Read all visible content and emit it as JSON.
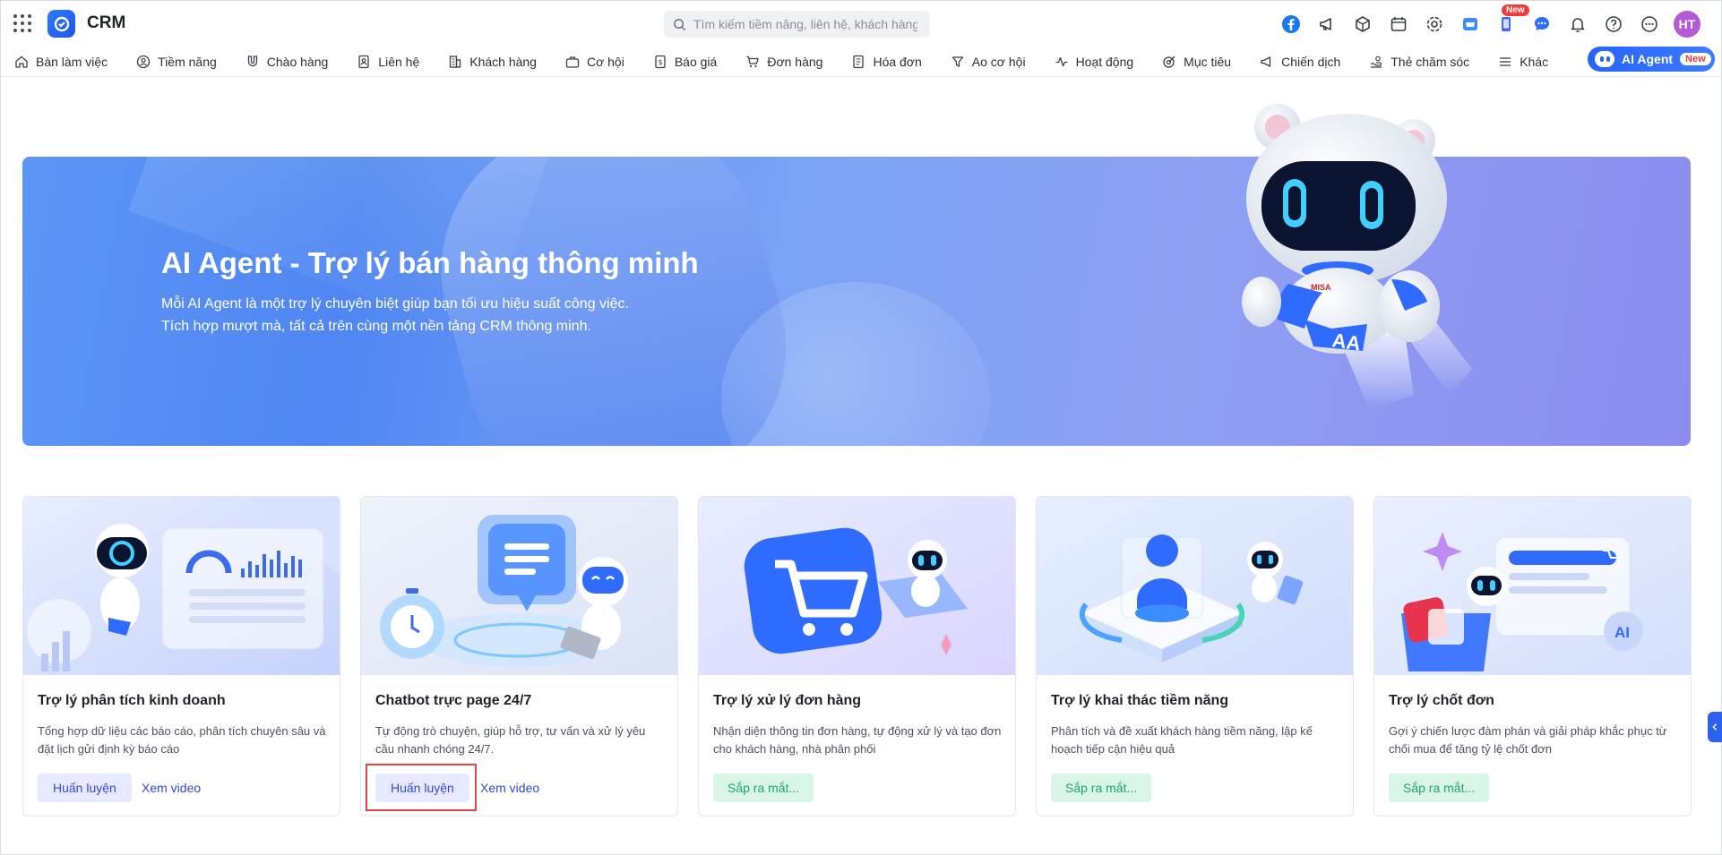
{
  "header": {
    "app_name": "CRM",
    "search_placeholder": "Tìm kiếm tiềm năng, liên hệ, khách hàng",
    "new_badge": "New",
    "avatar_initials": "HT"
  },
  "nav": {
    "items": [
      {
        "label": "Bàn làm việc",
        "icon": "home-icon"
      },
      {
        "label": "Tiềm năng",
        "icon": "prospect-icon"
      },
      {
        "label": "Chào hàng",
        "icon": "magnet-icon"
      },
      {
        "label": "Liên hệ",
        "icon": "contact-icon"
      },
      {
        "label": "Khách hàng",
        "icon": "building-icon"
      },
      {
        "label": "Cơ hội",
        "icon": "briefcase-icon"
      },
      {
        "label": "Báo giá",
        "icon": "quote-icon"
      },
      {
        "label": "Đơn hàng",
        "icon": "cart-icon"
      },
      {
        "label": "Hóa đơn",
        "icon": "invoice-icon"
      },
      {
        "label": "Ao cơ hội",
        "icon": "funnel-icon"
      },
      {
        "label": "Hoạt động",
        "icon": "activity-icon"
      },
      {
        "label": "Mục tiêu",
        "icon": "target-icon"
      },
      {
        "label": "Chiến dịch",
        "icon": "megaphone-icon"
      },
      {
        "label": "Thẻ chăm sóc",
        "icon": "care-card-icon"
      },
      {
        "label": "Khác",
        "icon": "menu-icon"
      }
    ],
    "ai_agent_label": "AI Agent",
    "ai_agent_badge": "New"
  },
  "banner": {
    "title": "AI Agent - Trợ lý bán hàng thông minh",
    "subtitle_line1": "Mỗi AI Agent là một trợ lý chuyên biệt giúp bạn tối ưu hiệu suất công việc.",
    "subtitle_line2": "Tích hợp mượt mà, tất cả trên cùng một nền tảng CRM thông minh.",
    "robot_badge": "MISA"
  },
  "cards": [
    {
      "title": "Trợ lý phân tích kinh doanh",
      "desc": "Tổng hợp dữ liệu các báo cáo, phân tích chuyên sâu và đặt lịch gửi định kỳ báo cáo",
      "train_label": "Huấn luyện",
      "video_label": "Xem video"
    },
    {
      "title": "Chatbot trực page 24/7",
      "desc": "Tự động trò chuyện, giúp hỗ trợ, tư vấn và xử lý yêu cầu nhanh chóng 24/7.",
      "train_label": "Huấn luyện",
      "video_label": "Xem video"
    },
    {
      "title": "Trợ lý xử lý đơn hàng",
      "desc": "Nhận diện thông tin đơn hàng, tự động xử lý và tạo đơn cho khách hàng, nhà phân phối",
      "soon_label": "Sắp ra mắt..."
    },
    {
      "title": "Trợ lý khai thác tiềm năng",
      "desc": "Phân tích và đề xuất khách hàng tiềm năng, lập kế hoạch tiếp cận hiệu quả",
      "soon_label": "Sắp ra mắt..."
    },
    {
      "title": "Trợ lý chốt đơn",
      "desc": "Gợi ý chiến lược đàm phán và giải pháp khắc phục từ chối mua để tăng tỷ lệ chốt đơn",
      "soon_label": "Sắp ra mắt..."
    }
  ],
  "colors": {
    "accent": "#2f4ad9",
    "brand": "#2663ff",
    "soon_green": "#1ba86b",
    "highlight_red": "#e14545"
  }
}
